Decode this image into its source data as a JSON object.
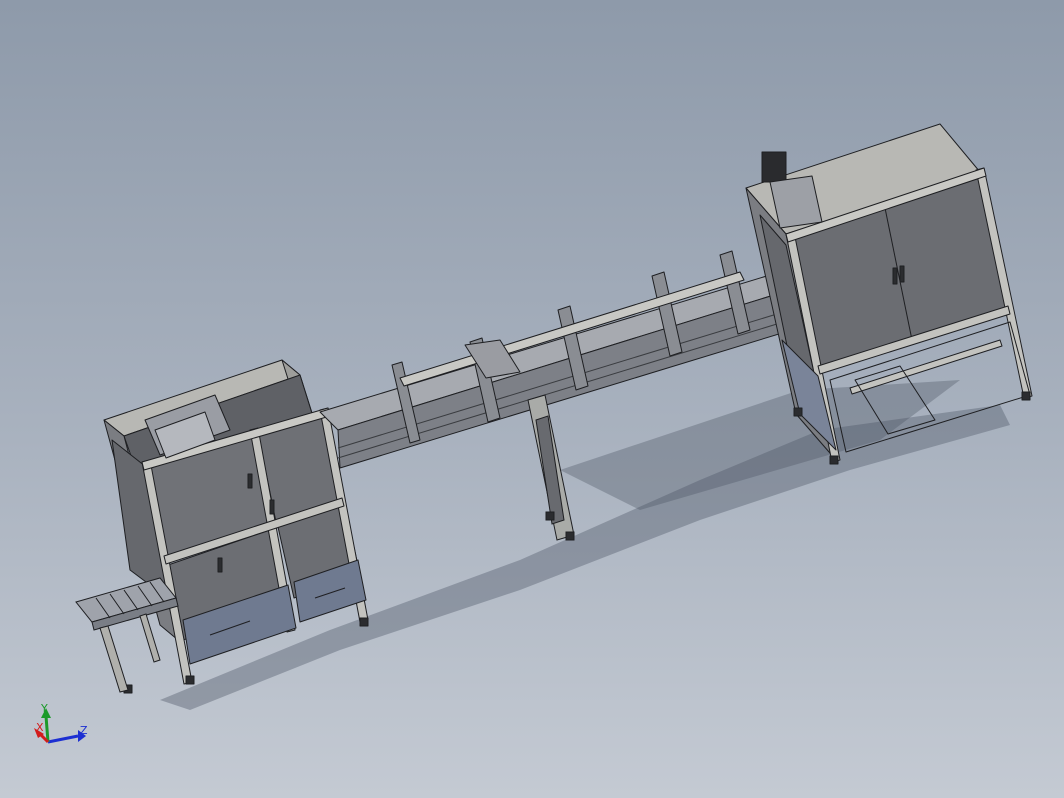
{
  "view": {
    "background_top": "#8e9aaa",
    "background_bottom": "#c4cad3",
    "panel_color": "#6f7176",
    "frame_color": "#b8b8b4",
    "edge_color": "#1e1f22"
  },
  "triad": {
    "x_label": "X",
    "y_label": "Y",
    "z_label": "Z",
    "x_color": "#d21c1c",
    "y_color": "#1c9a2a",
    "z_color": "#1c2fd2"
  }
}
